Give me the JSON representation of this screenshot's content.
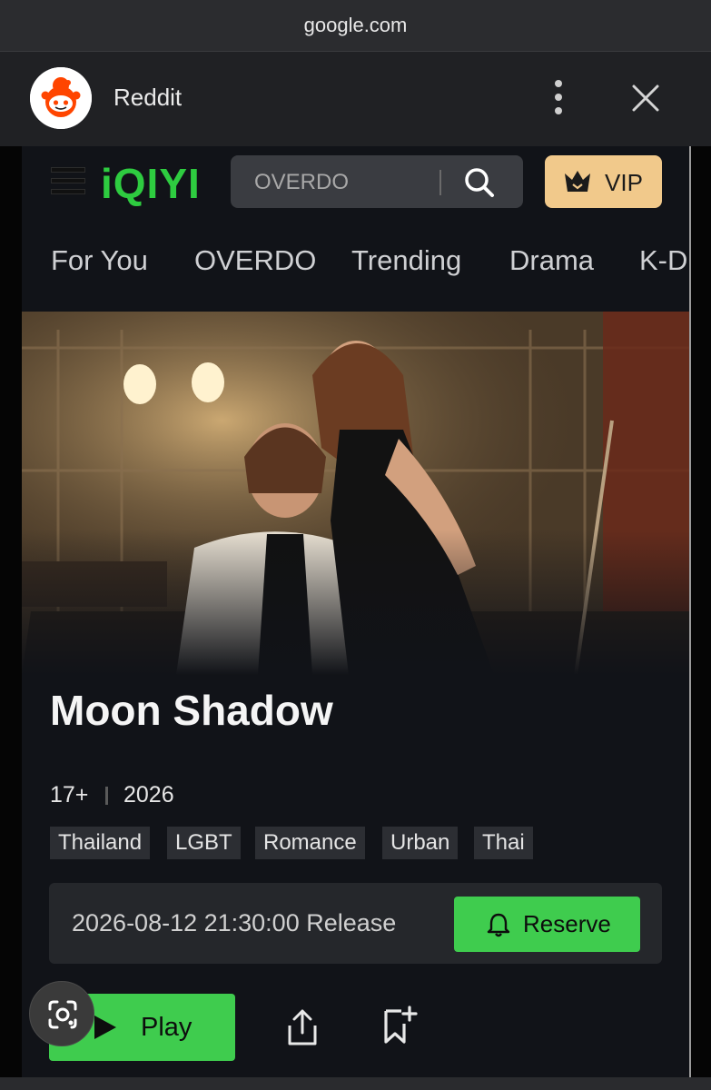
{
  "browser": {
    "url": "google.com"
  },
  "custom_tab": {
    "title": "Reddit",
    "logo_icon": "reddit-logo-icon",
    "menu_icon": "more-vert-icon",
    "close_icon": "close-icon"
  },
  "header": {
    "brand": "iQIYI",
    "brand_color": "#2ecc40",
    "search_placeholder": "OVERDO",
    "vip_label": "VIP",
    "vip_color": "#f1c98b"
  },
  "tabs": [
    "For You",
    "OVERDO",
    "Trending",
    "Drama",
    "K-Dr"
  ],
  "show": {
    "title": "Moon Shadow",
    "rating": "17+",
    "year": "2026",
    "genres": [
      "Thailand",
      "LGBT",
      "Romance",
      "Urban",
      "Thai"
    ]
  },
  "release": {
    "text": "2026-08-12 21:30:00 Release",
    "reserve_label": "Reserve"
  },
  "actions": {
    "play_label": "Play",
    "accent_color": "#3fcc4e"
  }
}
